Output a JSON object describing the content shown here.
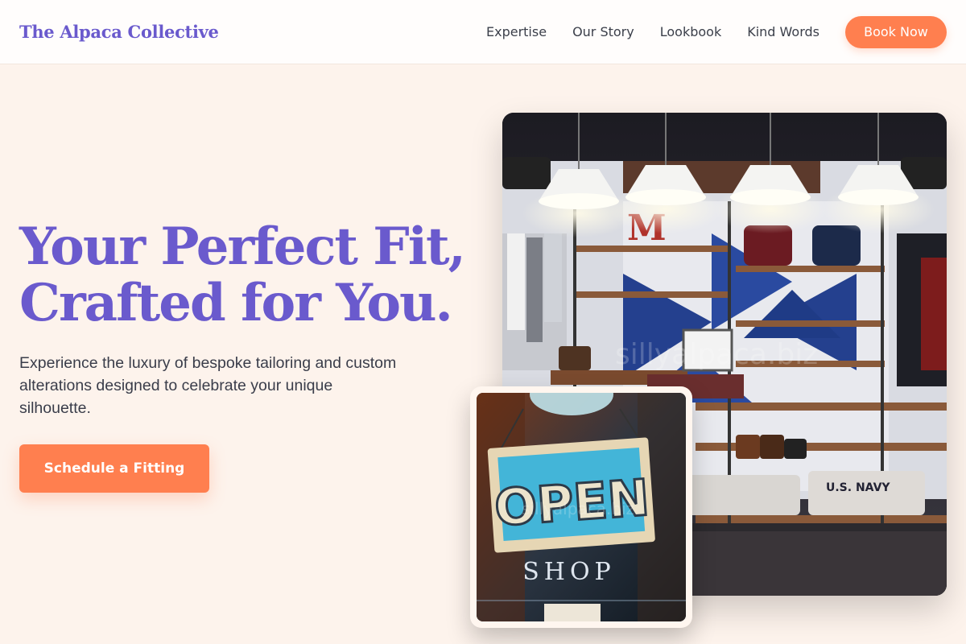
{
  "header": {
    "brand": "The Alpaca Collective",
    "nav": [
      "Expertise",
      "Our Story",
      "Lookbook",
      "Kind Words"
    ],
    "book_label": "Book Now"
  },
  "hero": {
    "headline_line1": "Your Perfect Fit,",
    "headline_line2": "Crafted for You.",
    "subtext": "Experience the luxury of bespoke tailoring and custom alterations designed to celebrate your unique silhouette.",
    "cta_label": "Schedule a Fitting"
  },
  "images": {
    "main_alt": "Clothing boutique interior with shelves and pendant lamps",
    "card_alt": "Open shop sign hanging on a door",
    "watermark": "sillyalpaca.biz",
    "sign_text": "OPEN",
    "sign_subtext": "SHOP",
    "wall_letter": "M",
    "tee_text": "U.S. NAVY"
  },
  "colors": {
    "brand": "#6a5acd",
    "accent": "#ff7f4f",
    "background": "#fdf3ec"
  }
}
